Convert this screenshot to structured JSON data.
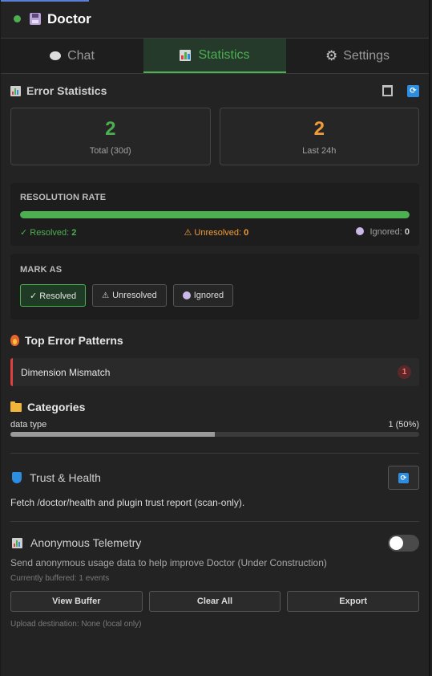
{
  "header": {
    "title": "Doctor"
  },
  "tabs": [
    {
      "label": "Chat",
      "icon": "chat-bubble-icon"
    },
    {
      "label": "Statistics",
      "icon": "bar-chart-icon",
      "active": true
    },
    {
      "label": "Settings",
      "icon": "gear-icon"
    }
  ],
  "error_stats": {
    "title": "Error Statistics",
    "total_value": "2",
    "total_label": "Total (30d)",
    "last24_value": "2",
    "last24_label": "Last 24h"
  },
  "resolution": {
    "caption": "RESOLUTION RATE",
    "resolved_fraction": 1.0,
    "resolved_label": "✓ Resolved:",
    "resolved_count": "2",
    "unresolved_label": "⚠ Unresolved:",
    "unresolved_count": "0",
    "ignored_label": "Ignored:",
    "ignored_count": "0"
  },
  "mark_as": {
    "caption": "MARK AS",
    "resolved": "✓ Resolved",
    "unresolved": "Unresolved",
    "ignored": "Ignored"
  },
  "patterns": {
    "title": "Top Error Patterns",
    "items": [
      {
        "name": "Dimension Mismatch",
        "count": "1"
      }
    ]
  },
  "categories": {
    "title": "Categories",
    "items": [
      {
        "name": "data type",
        "value": "1 (50%)",
        "fraction": 0.5
      }
    ]
  },
  "trust": {
    "title": "Trust & Health",
    "description": "Fetch /doctor/health and plugin trust report (scan-only)."
  },
  "telemetry": {
    "title": "Anonymous Telemetry",
    "description": "Send anonymous usage data to help improve Doctor (Under Construction)",
    "buffered": "Currently buffered: 1 events",
    "view_buffer": "View Buffer",
    "clear_all": "Clear All",
    "export": "Export",
    "destination": "Upload destination: None (local only)",
    "enabled": false
  },
  "colors": {
    "accent_green": "#4caf50",
    "accent_orange": "#f29b38",
    "accent_blue": "#2d8de0",
    "error_red": "#e04040"
  }
}
